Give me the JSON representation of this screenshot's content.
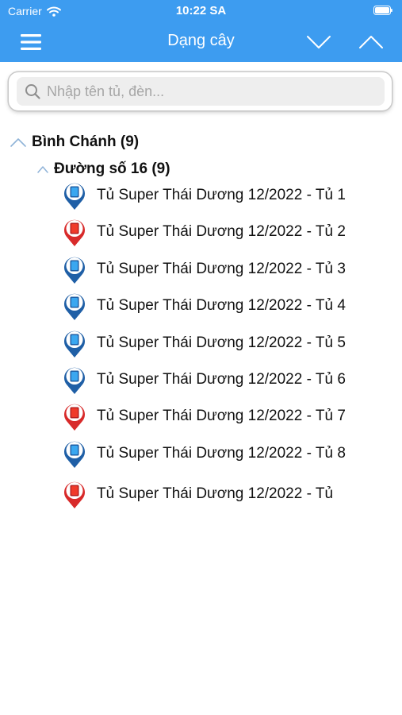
{
  "status_bar": {
    "carrier": "Carrier",
    "time": "10:22 SA",
    "wifi_icon": "wifi-icon",
    "battery_icon": "battery-icon"
  },
  "nav": {
    "title": "Dạng cây",
    "menu_icon": "hamburger-menu-icon",
    "collapse_icon": "chevron-down-icon",
    "expand_icon": "chevron-up-icon"
  },
  "search": {
    "placeholder": "Nhập tên tủ, đèn...",
    "value": ""
  },
  "colors": {
    "header": "#3d9cf0",
    "pin_blue": "#1f5fa6",
    "pin_red": "#d82a2a",
    "toggle": "#8fb3d8"
  },
  "tree": {
    "root": {
      "label": "Bình Chánh (9)",
      "expanded": true,
      "children": [
        {
          "label": "Đường số 16 (9)",
          "expanded": true,
          "items": [
            {
              "label": "Tủ Super Thái Dương 12/2022 - Tủ 1",
              "status": "blue"
            },
            {
              "label": "Tủ Super Thái Dương 12/2022 - Tủ 2",
              "status": "red"
            },
            {
              "label": "Tủ Super Thái Dương 12/2022 - Tủ 3",
              "status": "blue"
            },
            {
              "label": "Tủ Super Thái Dương 12/2022 - Tủ 4",
              "status": "blue"
            },
            {
              "label": "Tủ Super Thái Dương 12/2022 - Tủ 5",
              "status": "blue"
            },
            {
              "label": "Tủ Super Thái Dương 12/2022 - Tủ 6",
              "status": "blue"
            },
            {
              "label": "Tủ Super Thái Dương 12/2022 - Tủ 7",
              "status": "red"
            },
            {
              "label": "Tủ Super Thái Dương 12/2022 - Tủ 8",
              "status": "blue"
            },
            {
              "label": "Tủ Super Thái Dương 12/2022 - Tủ",
              "status": "red"
            }
          ]
        }
      ]
    }
  }
}
